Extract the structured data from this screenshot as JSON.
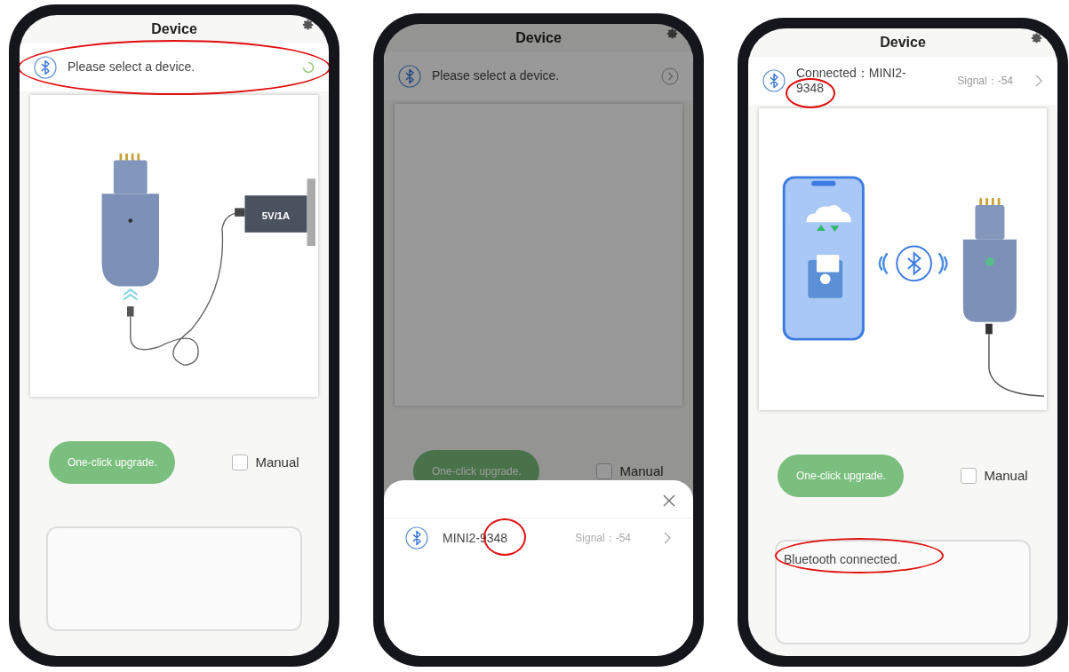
{
  "phones": [
    {
      "title": "Device",
      "device_bar": {
        "text": "Please select a device.",
        "status_icon": {
          "kind": "spinner"
        },
        "highlight": true
      },
      "illustration": {
        "kind": "charger",
        "adapter_label": "5V/1A"
      },
      "upgrade_button": "One-click upgrade.",
      "manual": {
        "label": "Manual",
        "checked": false
      }
    },
    {
      "title": "Device",
      "dimmed": true,
      "device_bar": {
        "text": "Please select a device.",
        "status_icon": {
          "kind": "chevron-circle"
        }
      },
      "illustration": {
        "kind": "blank"
      },
      "upgrade_button": "One-click upgrade.",
      "manual": {
        "label": "Manual",
        "checked": false
      },
      "sheet": {
        "devices": [
          {
            "name": "MINI2-9348",
            "signal": "Signal：-54",
            "highlight": true
          }
        ]
      }
    },
    {
      "title": "Device",
      "device_bar": {
        "text": "Connected：MINI2-9348",
        "status_icon": {
          "kind": "chevron"
        },
        "signal": "Signal：-54",
        "highlight": true
      },
      "illustration": {
        "kind": "transfer"
      },
      "upgrade_button": "One-click upgrade.",
      "manual": {
        "label": "Manual",
        "checked": false
      },
      "log": {
        "text": "Bluetooth connected.",
        "highlight": true
      }
    }
  ]
}
